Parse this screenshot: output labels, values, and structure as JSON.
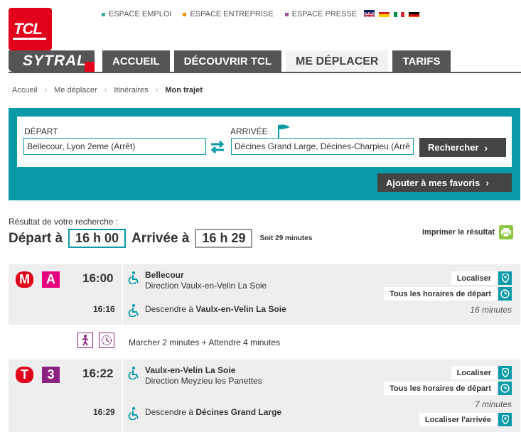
{
  "header": {
    "logo_text": "TCL",
    "brand": "SYTRAL",
    "top_links": [
      {
        "label": "ESPACE EMPLOI",
        "color": "#3aaa9e"
      },
      {
        "label": "ESPACE ENTREPRISE",
        "color": "#f39200"
      },
      {
        "label": "ESPACE PRESSE",
        "color": "#a0529b"
      }
    ],
    "languages": [
      "en-flag-icon",
      "es-flag-icon",
      "it-flag-icon",
      "de-flag-icon"
    ],
    "tabs": [
      {
        "label": "ACCUEIL",
        "active": false
      },
      {
        "label": "DÉCOUVRIR TCL",
        "active": false
      },
      {
        "label": "ME DÉPLACER",
        "active": true
      },
      {
        "label": "TARIFS",
        "active": false
      }
    ]
  },
  "breadcrumb": {
    "items": [
      "Accueil",
      "Me déplacer",
      "Itinéraires"
    ],
    "current": "Mon trajet"
  },
  "search": {
    "depart_label": "DÉPART",
    "depart_value": "Bellecour, Lyon 2eme (Arrêt)",
    "arrivee_label": "ARRIVÉE",
    "arrivee_value": "Décines Grand Large, Décines-Charpieu (Arrê",
    "search_button": "Rechercher",
    "favorites_button": "Ajouter à mes favoris"
  },
  "results": {
    "label": "Résultat de votre recherche :",
    "depart_prefix": "Départ à",
    "depart_time": "16 h 00",
    "arrivee_prefix": "Arrivée à",
    "arrivee_time": "16 h 29",
    "duration": "Soit 29 minutes",
    "print_label": "Imprimer le résultat"
  },
  "legs": [
    {
      "badges": [
        {
          "text": "M",
          "color": "#e2001a"
        },
        {
          "text": "A",
          "color": "#e6007e"
        }
      ],
      "start_time": "16:00",
      "end_time": "16:16",
      "from_name": "Bellecour",
      "direction": "Direction Vaulx-en-Velin La Soie",
      "alight_prefix": "Descendre à",
      "alight_stop": "Vaulx-en-Velin La Soie",
      "localiser": "Localiser",
      "horaires": "Tous les horaires de départ",
      "duration": "16 minutes"
    },
    {
      "badges": [
        {
          "text": "T",
          "color": "#e2001a"
        },
        {
          "text": "3",
          "color": "#8b2181"
        }
      ],
      "start_time": "16:22",
      "end_time": "16:29",
      "from_name": "Vaulx-en-Velin La Soie",
      "direction": "Direction Meyzieu les Panettes",
      "alight_prefix": "Descendre à",
      "alight_stop": "Décines Grand Large",
      "localiser": "Localiser",
      "horaires": "Tous les horaires de départ",
      "duration": "7 minutes",
      "localiser_arrivee": "Localiser l'arrivée"
    }
  ],
  "walk": {
    "text": "Marcher 2 minutes + Attendre 4 minutes"
  },
  "colors": {
    "accent": "#0a9aa8",
    "brand_red": "#e2001a",
    "dark_grey": "#555555"
  }
}
